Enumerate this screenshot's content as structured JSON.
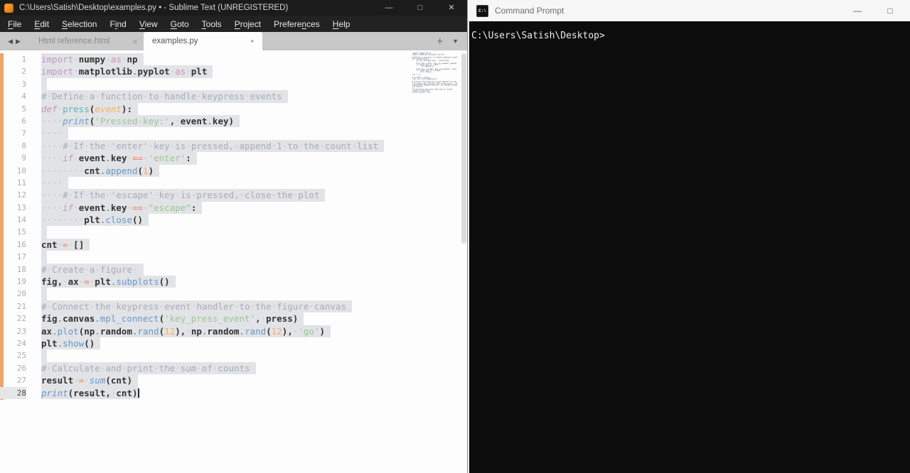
{
  "sublime": {
    "title": "C:\\Users\\Satish\\Desktop\\examples.py • - Sublime Text (UNREGISTERED)",
    "window_controls": {
      "minimize": "—",
      "maximize": "□",
      "close": "✕"
    },
    "menu": [
      {
        "label": "File",
        "u": 0
      },
      {
        "label": "Edit",
        "u": 0
      },
      {
        "label": "Selection",
        "u": 0
      },
      {
        "label": "Find",
        "u": 1
      },
      {
        "label": "View",
        "u": 0
      },
      {
        "label": "Goto",
        "u": 0
      },
      {
        "label": "Tools",
        "u": 0
      },
      {
        "label": "Project",
        "u": 0
      },
      {
        "label": "Preferences",
        "u": 7
      },
      {
        "label": "Help",
        "u": 0
      }
    ],
    "tab_nav": {
      "back": "◀",
      "forward": "▶",
      "new_tab": "+",
      "overflow": "▼"
    },
    "tabs": [
      {
        "label": "Html reference.html",
        "active": false,
        "closable": true,
        "modified": false,
        "close_glyph": "×"
      },
      {
        "label": "examples.py",
        "active": true,
        "closable": false,
        "modified": true,
        "modified_glyph": "•"
      }
    ],
    "code": {
      "active_line": 28,
      "lines": [
        {
          "n": 1,
          "tokens": [
            [
              "kw",
              "import "
            ],
            [
              "pl",
              "numpy "
            ],
            [
              "kw",
              "as "
            ],
            [
              "pl",
              "np"
            ]
          ]
        },
        {
          "n": 2,
          "tokens": [
            [
              "kw",
              "import "
            ],
            [
              "pl",
              "matplotlib"
            ],
            [
              "ac",
              "."
            ],
            [
              "pl",
              "pyplot "
            ],
            [
              "kw",
              "as "
            ],
            [
              "pl",
              "plt"
            ]
          ]
        },
        {
          "n": 3,
          "tokens": []
        },
        {
          "n": 4,
          "tokens": [
            [
              "cm",
              "# Define a function to handle keypress events"
            ]
          ]
        },
        {
          "n": 5,
          "tokens": [
            [
              "kwi",
              "def "
            ],
            [
              "fdef",
              "press"
            ],
            [
              "pn",
              "("
            ],
            [
              "par",
              "event"
            ],
            [
              "pn",
              "):"
            ]
          ]
        },
        {
          "n": 6,
          "tokens": [
            [
              "ws",
              "    "
            ],
            [
              "fni",
              "print"
            ],
            [
              "pn",
              "("
            ],
            [
              "str",
              "'Pressed key:'"
            ],
            [
              "pn",
              ", "
            ],
            [
              "pl",
              "event"
            ],
            [
              "ac",
              "."
            ],
            [
              "pl",
              "key"
            ],
            [
              "pn",
              ")"
            ]
          ]
        },
        {
          "n": 7,
          "tokens": [
            [
              "ws",
              "    "
            ]
          ]
        },
        {
          "n": 8,
          "tokens": [
            [
              "ws",
              "    "
            ],
            [
              "cm",
              "# If the 'enter' key is pressed, append 1 to the count list"
            ]
          ]
        },
        {
          "n": 9,
          "tokens": [
            [
              "ws",
              "    "
            ],
            [
              "kwi",
              "if "
            ],
            [
              "pl",
              "event"
            ],
            [
              "ac",
              "."
            ],
            [
              "pl",
              "key "
            ],
            [
              "op",
              "== "
            ],
            [
              "str",
              "'enter'"
            ],
            [
              "pn",
              ":"
            ]
          ]
        },
        {
          "n": 10,
          "tokens": [
            [
              "ws",
              "        "
            ],
            [
              "pl",
              "cnt"
            ],
            [
              "ac",
              "."
            ],
            [
              "fn",
              "append"
            ],
            [
              "pn",
              "("
            ],
            [
              "num",
              "1"
            ],
            [
              "pn",
              ")"
            ]
          ]
        },
        {
          "n": 11,
          "tokens": [
            [
              "ws",
              "    "
            ]
          ]
        },
        {
          "n": 12,
          "tokens": [
            [
              "ws",
              "    "
            ],
            [
              "cm",
              "# If the 'escape' key is pressed, close the plot"
            ]
          ]
        },
        {
          "n": 13,
          "tokens": [
            [
              "ws",
              "    "
            ],
            [
              "kwi",
              "if "
            ],
            [
              "pl",
              "event"
            ],
            [
              "ac",
              "."
            ],
            [
              "pl",
              "key "
            ],
            [
              "op",
              "== "
            ],
            [
              "str",
              "\"escape\""
            ],
            [
              "pn",
              ":"
            ]
          ]
        },
        {
          "n": 14,
          "tokens": [
            [
              "ws",
              "        "
            ],
            [
              "pl",
              "plt"
            ],
            [
              "ac",
              "."
            ],
            [
              "fn",
              "close"
            ],
            [
              "pn",
              "()"
            ]
          ]
        },
        {
          "n": 15,
          "tokens": []
        },
        {
          "n": 16,
          "tokens": [
            [
              "pl",
              "cnt "
            ],
            [
              "op",
              "= "
            ],
            [
              "pn",
              "[]"
            ]
          ]
        },
        {
          "n": 17,
          "tokens": []
        },
        {
          "n": 18,
          "tokens": [
            [
              "cm",
              "# Create a figure "
            ]
          ]
        },
        {
          "n": 19,
          "tokens": [
            [
              "pl",
              "fig"
            ],
            [
              "pn",
              ", "
            ],
            [
              "pl",
              "ax "
            ],
            [
              "op",
              "= "
            ],
            [
              "pl",
              "plt"
            ],
            [
              "ac",
              "."
            ],
            [
              "fn",
              "subplots"
            ],
            [
              "pn",
              "()"
            ]
          ]
        },
        {
          "n": 20,
          "tokens": []
        },
        {
          "n": 21,
          "tokens": [
            [
              "cm",
              "# Connect the keypress event handler to the figure canvas"
            ]
          ]
        },
        {
          "n": 22,
          "tokens": [
            [
              "pl",
              "fig"
            ],
            [
              "ac",
              "."
            ],
            [
              "pl",
              "canvas"
            ],
            [
              "ac",
              "."
            ],
            [
              "fn",
              "mpl_connect"
            ],
            [
              "pn",
              "("
            ],
            [
              "str",
              "'key_press_event'"
            ],
            [
              "pn",
              ", "
            ],
            [
              "pl",
              "press"
            ],
            [
              "pn",
              ")"
            ]
          ]
        },
        {
          "n": 23,
          "tokens": [
            [
              "pl",
              "ax"
            ],
            [
              "ac",
              "."
            ],
            [
              "fn",
              "plot"
            ],
            [
              "pn",
              "("
            ],
            [
              "pl",
              "np"
            ],
            [
              "ac",
              "."
            ],
            [
              "pl",
              "random"
            ],
            [
              "ac",
              "."
            ],
            [
              "fn",
              "rand"
            ],
            [
              "pn",
              "("
            ],
            [
              "num",
              "12"
            ],
            [
              "pn",
              "), "
            ],
            [
              "pl",
              "np"
            ],
            [
              "ac",
              "."
            ],
            [
              "pl",
              "random"
            ],
            [
              "ac",
              "."
            ],
            [
              "fn",
              "rand"
            ],
            [
              "pn",
              "("
            ],
            [
              "num",
              "12"
            ],
            [
              "pn",
              "), "
            ],
            [
              "str",
              "'go'"
            ],
            [
              "pn",
              ")"
            ]
          ]
        },
        {
          "n": 24,
          "tokens": [
            [
              "pl",
              "plt"
            ],
            [
              "ac",
              "."
            ],
            [
              "fn",
              "show"
            ],
            [
              "pn",
              "()"
            ]
          ]
        },
        {
          "n": 25,
          "tokens": []
        },
        {
          "n": 26,
          "tokens": [
            [
              "cm",
              "# Calculate and print the sum of counts"
            ]
          ]
        },
        {
          "n": 27,
          "tokens": [
            [
              "pl",
              "result "
            ],
            [
              "op",
              "= "
            ],
            [
              "fni",
              "sum"
            ],
            [
              "pn",
              "("
            ],
            [
              "pl",
              "cnt"
            ],
            [
              "pn",
              ")"
            ]
          ]
        },
        {
          "n": 28,
          "tokens": [
            [
              "fni",
              "print"
            ],
            [
              "pn",
              "("
            ],
            [
              "pl",
              "result"
            ],
            [
              "pn",
              ", "
            ],
            [
              "pl",
              "cnt"
            ],
            [
              "pn",
              ")"
            ]
          ]
        }
      ]
    }
  },
  "cmd": {
    "title": "Command Prompt",
    "icon_label": "C:\\",
    "window_controls": {
      "minimize": "—",
      "maximize": "□"
    },
    "prompt": "C:\\Users\\Satish\\Desktop>"
  },
  "colors": {
    "git_modified_strip": "#f0a563",
    "selection": "#e2e3e6",
    "keyword": "#c594c5",
    "function_call": "#6699cc",
    "function_def": "#5fb4b4",
    "string": "#99c794",
    "number": "#f9ae58",
    "operator": "#f97b58",
    "comment": "#a6acb9",
    "console_background": "#0c0c0c"
  }
}
